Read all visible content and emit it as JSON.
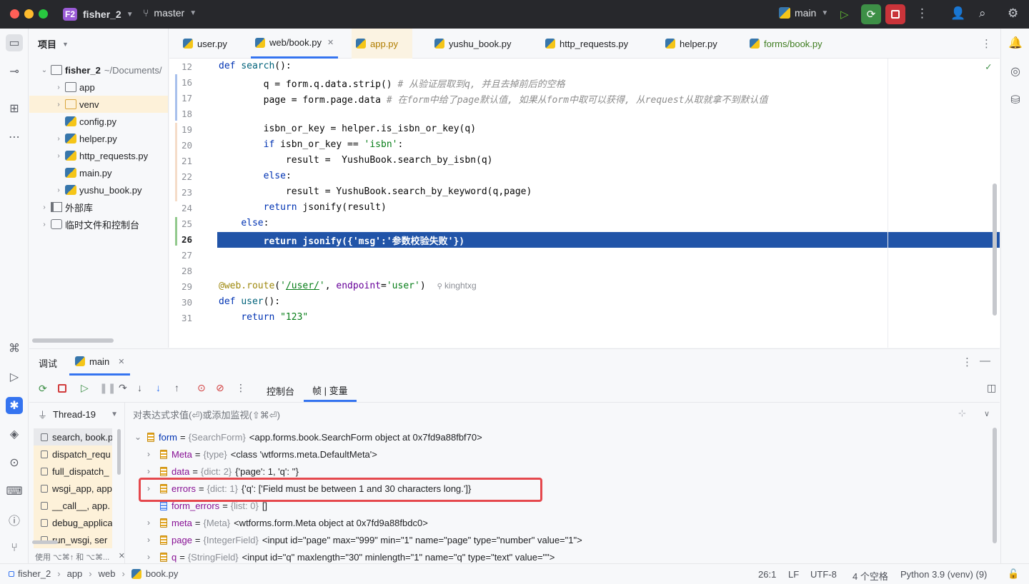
{
  "titlebar": {
    "project_badge": "F2",
    "project_name": "fisher_2",
    "branch": "master",
    "run_config": "main"
  },
  "left_strip_icons": [
    "folder-icon",
    "commit-icon",
    "structure-icon",
    "more-icon",
    "python-console-icon",
    "run-icon",
    "debug-icon",
    "layers-icon",
    "services-icon",
    "terminal-icon",
    "problems-icon",
    "git-icon"
  ],
  "project": {
    "title": "项目",
    "tree": [
      {
        "label": "fisher_2",
        "extra": "~/Documents/",
        "level": 0,
        "chev": "down",
        "icon": "folder"
      },
      {
        "label": "app",
        "level": 1,
        "chev": "right",
        "icon": "package"
      },
      {
        "label": "venv",
        "level": 1,
        "chev": "right",
        "icon": "folder-orange",
        "selected": true
      },
      {
        "label": "config.py",
        "level": 1,
        "chev": "",
        "icon": "python"
      },
      {
        "label": "helper.py",
        "level": 1,
        "chev": "right",
        "icon": "python"
      },
      {
        "label": "http_requests.py",
        "level": 1,
        "chev": "right",
        "icon": "python"
      },
      {
        "label": "main.py",
        "level": 1,
        "chev": "",
        "icon": "python"
      },
      {
        "label": "yushu_book.py",
        "level": 1,
        "chev": "right",
        "icon": "python"
      },
      {
        "label": "外部库",
        "level": 0,
        "chev": "right",
        "icon": "library"
      },
      {
        "label": "临时文件和控制台",
        "level": 0,
        "chev": "right",
        "icon": "scratch"
      }
    ]
  },
  "tabs": [
    {
      "label": "user.py",
      "active": false,
      "color": "#1e1f22"
    },
    {
      "label": "web/book.py",
      "active": true,
      "color": "#1e1f22"
    },
    {
      "label": "app.py",
      "active": false,
      "color": "#b07d00"
    },
    {
      "label": "yushu_book.py",
      "active": false,
      "color": "#1e1f22"
    },
    {
      "label": "http_requests.py",
      "active": false,
      "color": "#1e1f22"
    },
    {
      "label": "helper.py",
      "active": false,
      "color": "#1e1f22"
    },
    {
      "label": "forms/book.py",
      "active": false,
      "color": "#3f7d20"
    }
  ],
  "editor": {
    "lines": [
      {
        "n": "12",
        "html": "<span class='kw'>def</span> <span class='fn'>search</span>():"
      },
      {
        "n": "16",
        "html": "        q = form.q.data.strip() <span class='cmt'># 从验证层取到q, 并且去掉前后的空格</span>"
      },
      {
        "n": "17",
        "html": "        page = form.page.data <span class='cmt'># 在form中给了page默认值, 如果从form中取可以获得, 从request从取就拿不到默认值</span>"
      },
      {
        "n": "18",
        "html": ""
      },
      {
        "n": "19",
        "html": "        isbn_or_key = helper.is_isbn_or_key(q)"
      },
      {
        "n": "20",
        "html": "        <span class='kw'>if</span> isbn_or_key == <span class='str'>'isbn'</span>:"
      },
      {
        "n": "21",
        "html": "            result =  YushuBook.search_by_isbn(q)"
      },
      {
        "n": "22",
        "html": "        <span class='kw'>else</span>:"
      },
      {
        "n": "23",
        "html": "            result = YushuBook.search_by_keyword(q,page)"
      },
      {
        "n": "24",
        "html": "        <span class='kw'>return</span> jsonify(result)"
      },
      {
        "n": "25",
        "html": "    <span class='kw'>else</span>:"
      },
      {
        "n": "26",
        "html": "        return jsonify({'msg':'参数校验失败'})",
        "highlight": true
      },
      {
        "n": "27",
        "html": ""
      },
      {
        "n": "28",
        "html": ""
      },
      {
        "n": "29",
        "html": "<span class='dec'>@web.route</span>(<span class='str'>'<u>/user/</u>'</span>, <span class='prm'>endpoint</span>=<span class='str'>'user'</span>)"
      },
      {
        "n": "30",
        "html": "<span class='kw'>def</span> <span class='fn'>user</span>():"
      },
      {
        "n": "31",
        "html": "    <span class='kw'>return</span> <span class='str'>\"123\"</span>"
      }
    ],
    "author_hint": "kinghtxg"
  },
  "debug": {
    "tab_title": "调试",
    "session": "main",
    "subtab_console": "控制台",
    "subtab_frames": "帧 | 变量",
    "thread": "Thread-19",
    "watch_placeholder": "对表达式求值(⏎)或添加监视(⇧⌘⏎)",
    "frames": [
      "search, book.p",
      "dispatch_requ",
      "full_dispatch_",
      "wsgi_app, app",
      "__call__, app.",
      "debug_applica",
      "run_wsgi, ser"
    ],
    "frames_hint": "使用 ⌥⌘↑ 和 ⌥⌘...",
    "vars": [
      {
        "name": "form",
        "type": "{SearchForm}",
        "value": "<app.forms.book.SearchForm object at 0x7fd9a88fbf70>",
        "level": 0,
        "chev": "down"
      },
      {
        "name": "Meta",
        "type": "{type}",
        "value": "<class 'wtforms.meta.DefaultMeta'>",
        "level": 1,
        "chev": "right"
      },
      {
        "name": "data",
        "type": "{dict: 2}",
        "value": "{'page': 1, 'q': ''}",
        "level": 1,
        "chev": "right"
      },
      {
        "name": "errors",
        "type": "{dict: 1}",
        "value": "{'q': ['Field must be between 1 and 30 characters long.']}",
        "level": 1,
        "chev": "right",
        "boxed": true
      },
      {
        "name": "form_errors",
        "type": "{list: 0}",
        "value": "[]",
        "level": 1,
        "chev": "",
        "list": true
      },
      {
        "name": "meta",
        "type": "{Meta}",
        "value": "<wtforms.form.Meta object at 0x7fd9a88fbdc0>",
        "level": 1,
        "chev": "right"
      },
      {
        "name": "page",
        "type": "{IntegerField}",
        "value": "<input id=\"page\" max=\"999\" min=\"1\" name=\"page\" type=\"number\" value=\"1\">",
        "level": 1,
        "chev": "right"
      },
      {
        "name": "q",
        "type": "{StringField}",
        "value": "<input id=\"q\" maxlength=\"30\" minlength=\"1\" name=\"q\" type=\"text\" value=\"\">",
        "level": 1,
        "chev": "right"
      }
    ]
  },
  "status": {
    "breadcrumb": [
      "fisher_2",
      "app",
      "web",
      "book.py"
    ],
    "position": "26:1",
    "line_sep": "LF",
    "encoding": "UTF-8",
    "indent": "4 个空格",
    "interpreter": "Python 3.9 (venv) (9)"
  },
  "colors": {
    "accent": "#3574f0",
    "highlight": "#2154a8",
    "error_box": "#e5484d",
    "selected_row": "#fdf1d9"
  }
}
